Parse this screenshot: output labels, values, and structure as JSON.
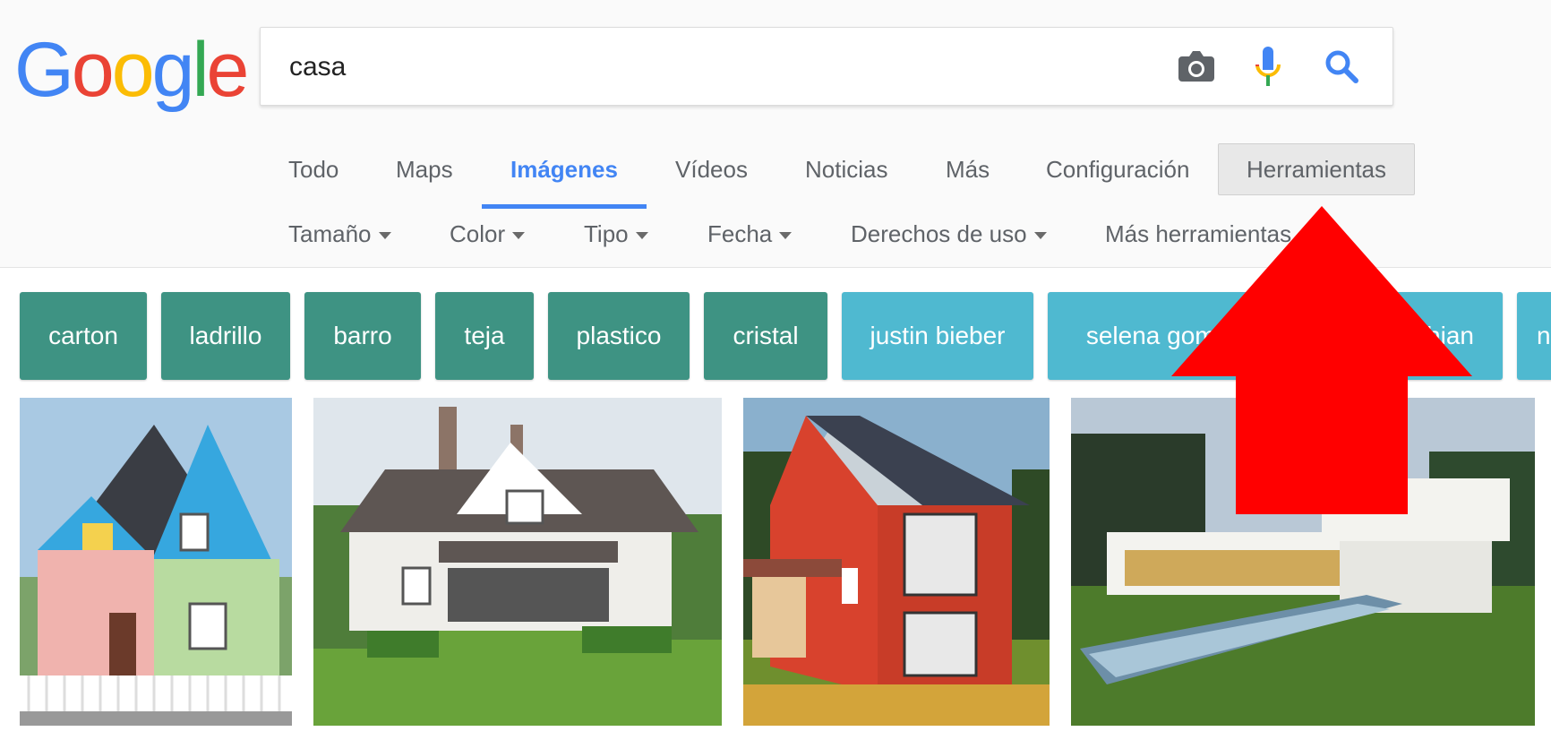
{
  "logo": {
    "letters": [
      "G",
      "o",
      "o",
      "g",
      "l",
      "e"
    ],
    "colors": [
      "#4285f4",
      "#ea4335",
      "#fbbc05",
      "#4285f4",
      "#34a853",
      "#ea4335"
    ]
  },
  "search": {
    "query": "casa"
  },
  "icons": {
    "camera": "camera-icon",
    "mic": "microphone-icon",
    "search": "search-icon"
  },
  "tabs": [
    {
      "label": "Todo"
    },
    {
      "label": "Maps"
    },
    {
      "label": "Imágenes"
    },
    {
      "label": "Vídeos"
    },
    {
      "label": "Noticias"
    },
    {
      "label": "Más"
    },
    {
      "label": "Configuración"
    }
  ],
  "active_tab": "Imágenes",
  "tools": {
    "label": "Herramientas"
  },
  "filters": [
    {
      "label": "Tamaño"
    },
    {
      "label": "Color"
    },
    {
      "label": "Tipo"
    },
    {
      "label": "Fecha"
    },
    {
      "label": "Derechos de uso"
    },
    {
      "label": "Más herramientas"
    }
  ],
  "chips": [
    {
      "label": "carton"
    },
    {
      "label": "ladrillo"
    },
    {
      "label": "barro"
    },
    {
      "label": "teja"
    },
    {
      "label": "plastico"
    },
    {
      "label": "cristal"
    },
    {
      "label": "justin bieber"
    },
    {
      "label": "selena gomez"
    },
    {
      "label": "kardashian"
    },
    {
      "label": "n"
    }
  ],
  "colors": {
    "accent": "#4285f4",
    "chip_green": "#3e9383",
    "chip_blue": "#4fb9d0",
    "arrow": "#ff0000"
  }
}
